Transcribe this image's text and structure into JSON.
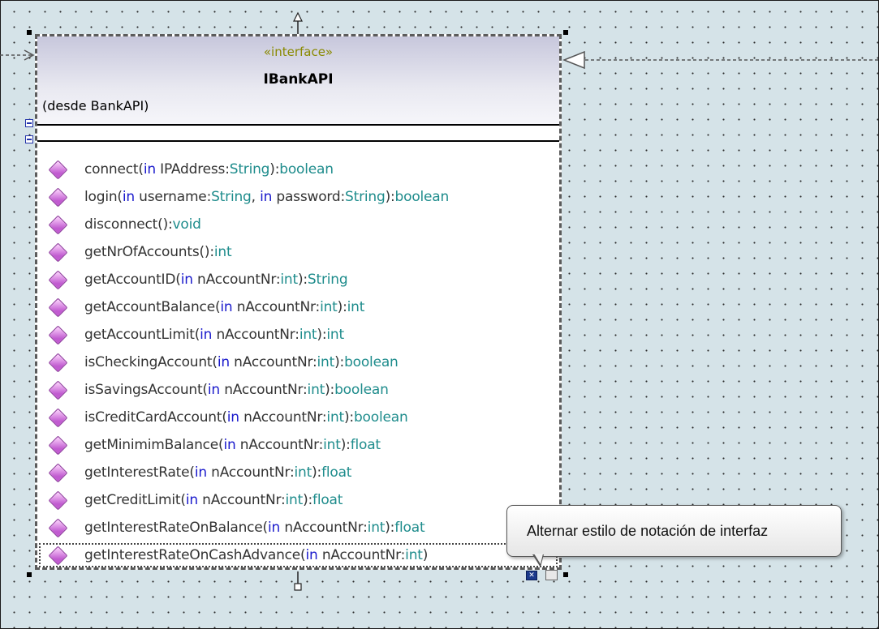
{
  "classifier": {
    "stereotype": "«interface»",
    "name": "IBankAPI",
    "namespace": "(desde BankAPI)"
  },
  "operations": [
    [
      {
        "t": "connect(",
        "c": "n"
      },
      {
        "t": "in",
        "c": "k"
      },
      {
        "t": " IPAddress:",
        "c": "n"
      },
      {
        "t": "String",
        "c": "t"
      },
      {
        "t": "):",
        "c": "n"
      },
      {
        "t": "boolean",
        "c": "t"
      }
    ],
    [
      {
        "t": "login(",
        "c": "n"
      },
      {
        "t": "in",
        "c": "k"
      },
      {
        "t": " username:",
        "c": "n"
      },
      {
        "t": "String",
        "c": "t"
      },
      {
        "t": ", ",
        "c": "n"
      },
      {
        "t": "in",
        "c": "k"
      },
      {
        "t": " password:",
        "c": "n"
      },
      {
        "t": "String",
        "c": "t"
      },
      {
        "t": "):",
        "c": "n"
      },
      {
        "t": "boolean",
        "c": "t"
      }
    ],
    [
      {
        "t": "disconnect():",
        "c": "n"
      },
      {
        "t": "void",
        "c": "t"
      }
    ],
    [
      {
        "t": "getNrOfAccounts():",
        "c": "n"
      },
      {
        "t": "int",
        "c": "t"
      }
    ],
    [
      {
        "t": "getAccountID(",
        "c": "n"
      },
      {
        "t": "in",
        "c": "k"
      },
      {
        "t": " nAccountNr:",
        "c": "n"
      },
      {
        "t": "int",
        "c": "t"
      },
      {
        "t": "):",
        "c": "n"
      },
      {
        "t": "String",
        "c": "t"
      }
    ],
    [
      {
        "t": "getAccountBalance(",
        "c": "n"
      },
      {
        "t": "in",
        "c": "k"
      },
      {
        "t": " nAccountNr:",
        "c": "n"
      },
      {
        "t": "int",
        "c": "t"
      },
      {
        "t": "):",
        "c": "n"
      },
      {
        "t": "int",
        "c": "t"
      }
    ],
    [
      {
        "t": "getAccountLimit(",
        "c": "n"
      },
      {
        "t": "in",
        "c": "k"
      },
      {
        "t": " nAccountNr:",
        "c": "n"
      },
      {
        "t": "int",
        "c": "t"
      },
      {
        "t": "):",
        "c": "n"
      },
      {
        "t": "int",
        "c": "t"
      }
    ],
    [
      {
        "t": "isCheckingAccount(",
        "c": "n"
      },
      {
        "t": "in",
        "c": "k"
      },
      {
        "t": " nAccountNr:",
        "c": "n"
      },
      {
        "t": "int",
        "c": "t"
      },
      {
        "t": "):",
        "c": "n"
      },
      {
        "t": "boolean",
        "c": "t"
      }
    ],
    [
      {
        "t": "isSavingsAccount(",
        "c": "n"
      },
      {
        "t": "in",
        "c": "k"
      },
      {
        "t": " nAccountNr:",
        "c": "n"
      },
      {
        "t": "int",
        "c": "t"
      },
      {
        "t": "):",
        "c": "n"
      },
      {
        "t": "boolean",
        "c": "t"
      }
    ],
    [
      {
        "t": "isCreditCardAccount(",
        "c": "n"
      },
      {
        "t": "in",
        "c": "k"
      },
      {
        "t": " nAccountNr:",
        "c": "n"
      },
      {
        "t": "int",
        "c": "t"
      },
      {
        "t": "):",
        "c": "n"
      },
      {
        "t": "boolean",
        "c": "t"
      }
    ],
    [
      {
        "t": "getMinimimBalance(",
        "c": "n"
      },
      {
        "t": "in",
        "c": "k"
      },
      {
        "t": " nAccountNr:",
        "c": "n"
      },
      {
        "t": "int",
        "c": "t"
      },
      {
        "t": "):",
        "c": "n"
      },
      {
        "t": "float",
        "c": "t"
      }
    ],
    [
      {
        "t": "getInterestRate(",
        "c": "n"
      },
      {
        "t": "in",
        "c": "k"
      },
      {
        "t": " nAccountNr:",
        "c": "n"
      },
      {
        "t": "int",
        "c": "t"
      },
      {
        "t": "):",
        "c": "n"
      },
      {
        "t": "float",
        "c": "t"
      }
    ],
    [
      {
        "t": "getCreditLimit(",
        "c": "n"
      },
      {
        "t": "in",
        "c": "k"
      },
      {
        "t": " nAccountNr:",
        "c": "n"
      },
      {
        "t": "int",
        "c": "t"
      },
      {
        "t": "):",
        "c": "n"
      },
      {
        "t": "float",
        "c": "t"
      }
    ],
    [
      {
        "t": "getInterestRateOnBalance(",
        "c": "n"
      },
      {
        "t": "in",
        "c": "k"
      },
      {
        "t": " nAccountNr:",
        "c": "n"
      },
      {
        "t": "int",
        "c": "t"
      },
      {
        "t": "):",
        "c": "n"
      },
      {
        "t": "float",
        "c": "t"
      }
    ],
    [
      {
        "t": "getInterestRateOnCashAdvance(",
        "c": "n"
      },
      {
        "t": "in",
        "c": "k"
      },
      {
        "t": " nAccountNr:",
        "c": "n"
      },
      {
        "t": "int",
        "c": "t"
      },
      {
        "t": ")",
        "c": "n"
      }
    ]
  ],
  "selected_operation_index": 14,
  "tooltip": {
    "text": "Alternar estilo de notación de interfaz"
  },
  "icons": {
    "operation": "operation-diamond-icon",
    "toggle_notation": "toggle-notation-icon",
    "folder": "folder-icon"
  },
  "colors": {
    "canvas": "#d5e3e8",
    "keyword": "#1a1acc",
    "type": "#1e8c8c",
    "stereotype": "#8a8a00",
    "operation_icon": "#c15bd0"
  }
}
